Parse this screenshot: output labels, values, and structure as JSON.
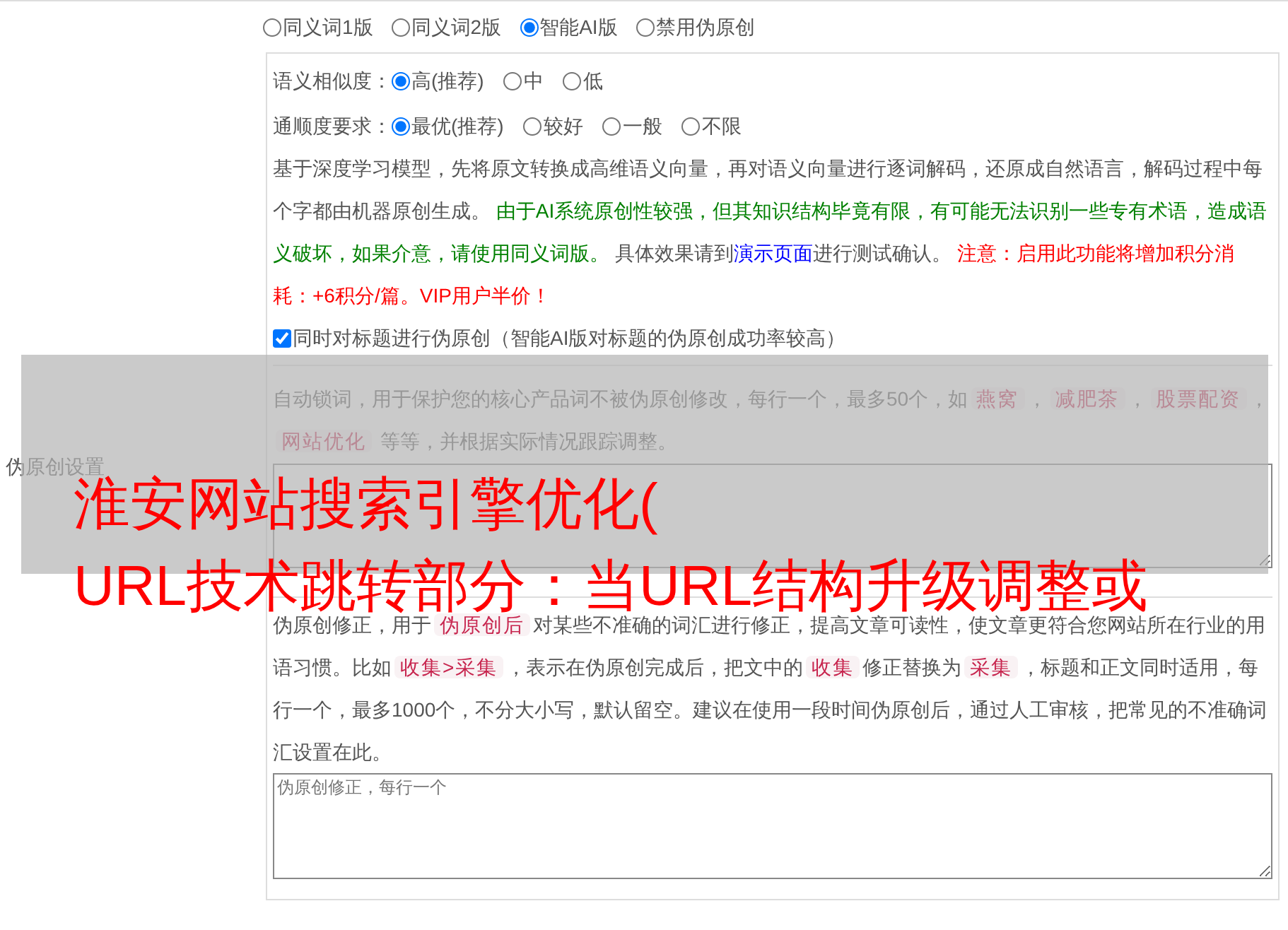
{
  "side_label": "伪原创设置",
  "modes": [
    {
      "label": "同义词1版",
      "selected": false
    },
    {
      "label": "同义词2版",
      "selected": false
    },
    {
      "label": "智能AI版",
      "selected": true
    },
    {
      "label": "禁用伪原创",
      "selected": false
    }
  ],
  "similarity": {
    "label": "语义相似度：",
    "options": [
      {
        "label": "高(推荐)",
        "selected": true
      },
      {
        "label": "中",
        "selected": false
      },
      {
        "label": "低",
        "selected": false
      }
    ]
  },
  "fluency": {
    "label": "通顺度要求：",
    "options": [
      {
        "label": "最优(推荐)",
        "selected": true
      },
      {
        "label": "较好",
        "selected": false
      },
      {
        "label": "一般",
        "selected": false
      },
      {
        "label": "不限",
        "selected": false
      }
    ]
  },
  "ai_description": [
    {
      "kind": "text",
      "text": "基于深度学习模型，先将原文转换成高维语义向量，再对语义向量进行逐词解码，还原成自然语言，解码过程中每个字都由机器原创生成。 "
    },
    {
      "kind": "note",
      "text": "由于AI系统原创性较强，但其知识结构毕竟有限，有可能无法识别一些专有术语，造成语义破坏，如果介意，请使用同义词版。"
    },
    {
      "kind": "text",
      "text": " 具体效果请到"
    },
    {
      "kind": "link",
      "text": "演示页面"
    },
    {
      "kind": "text",
      "text": "进行测试确认。 "
    },
    {
      "kind": "warning",
      "text": "注意：启用此功能将增加积分消耗：+6积分/篇。VIP用户半价！"
    }
  ],
  "title_option": {
    "label": "同时对标题进行伪原创（智能AI版对标题的伪原创成功率较高）",
    "checked": true
  },
  "lock_words": {
    "description": [
      {
        "kind": "text",
        "text": "自动锁词，用于保护您的核心产品词不被伪原创修改，每行一个，最多50个，如"
      },
      {
        "kind": "code",
        "text": "燕窝"
      },
      {
        "kind": "text",
        "text": "，"
      },
      {
        "kind": "code",
        "text": "减肥茶"
      },
      {
        "kind": "text",
        "text": "，"
      },
      {
        "kind": "code",
        "text": "股票配资"
      },
      {
        "kind": "text",
        "text": "，"
      },
      {
        "kind": "code",
        "text": "网站优化"
      },
      {
        "kind": "text",
        "text": " 等等，并根据实际情况跟踪调整。"
      }
    ]
  },
  "corrections": {
    "description": [
      {
        "kind": "text",
        "text": "伪原创修正，用于"
      },
      {
        "kind": "code",
        "text": "伪原创后"
      },
      {
        "kind": "text",
        "text": "对某些不准确的词汇进行修正，提高文章可读性，使文章更符合您网站所在行业的用语习惯。比如"
      },
      {
        "kind": "code",
        "text": "收集>采集"
      },
      {
        "kind": "text",
        "text": "，表示在伪原创完成后，把文中的"
      },
      {
        "kind": "code",
        "text": "收集"
      },
      {
        "kind": "text",
        "text": "修正替换为"
      },
      {
        "kind": "code",
        "text": "采集"
      },
      {
        "kind": "text",
        "text": "，标题和正文同时适用，每行一个，最多1000个，不分大小写，默认留空。建议在使用一段时间伪原创后，通过人工审核，把常见的不准确词汇设置在此。"
      }
    ],
    "placeholder": "伪原创修正，每行一个"
  },
  "overlay_title": [
    "淮安网站搜索引擎优化(",
    "URL技术跳转部分：当URL结构升级调整或"
  ]
}
